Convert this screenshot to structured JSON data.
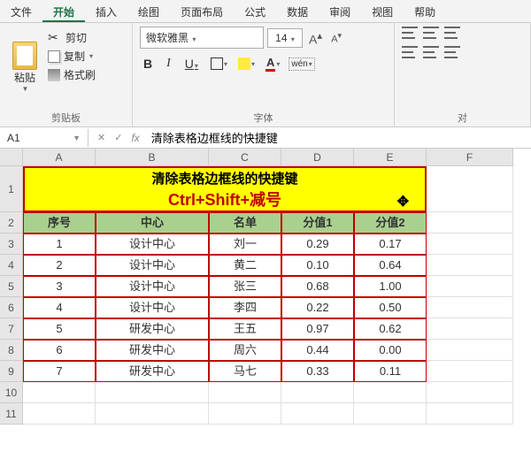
{
  "menu": {
    "items": [
      "文件",
      "开始",
      "插入",
      "绘图",
      "页面布局",
      "公式",
      "数据",
      "审阅",
      "视图",
      "帮助"
    ],
    "active_index": 1
  },
  "ribbon": {
    "clipboard": {
      "paste": "粘贴",
      "cut": "剪切",
      "copy": "复制",
      "format_painter": "格式刷",
      "group_label": "剪贴板"
    },
    "font": {
      "name": "微软雅黑",
      "size": "14",
      "increase": "A",
      "decrease": "A",
      "bold": "B",
      "italic": "I",
      "underline": "U",
      "font_color_glyph": "A",
      "phonetic": "wén",
      "group_label": "字体"
    },
    "align": {
      "group_label": "对"
    }
  },
  "namebox": "A1",
  "formula_fx": "fx",
  "formula_value": "清除表格边框线的快捷键",
  "columns": [
    "A",
    "B",
    "C",
    "D",
    "E",
    "F"
  ],
  "row_labels": [
    "1",
    "2",
    "3",
    "4",
    "5",
    "6",
    "7",
    "8",
    "9",
    "10",
    "11"
  ],
  "banner": {
    "title": "清除表格边框线的快捷键",
    "subtitle": "Ctrl+Shift+减号"
  },
  "table": {
    "headers": [
      "序号",
      "中心",
      "名单",
      "分值1",
      "分值2"
    ],
    "rows": [
      [
        "1",
        "设计中心",
        "刘一",
        "0.29",
        "0.17"
      ],
      [
        "2",
        "设计中心",
        "黄二",
        "0.10",
        "0.64"
      ],
      [
        "3",
        "设计中心",
        "张三",
        "0.68",
        "1.00"
      ],
      [
        "4",
        "设计中心",
        "李四",
        "0.22",
        "0.50"
      ],
      [
        "5",
        "研发中心",
        "王五",
        "0.97",
        "0.62"
      ],
      [
        "6",
        "研发中心",
        "周六",
        "0.44",
        "0.00"
      ],
      [
        "7",
        "研发中心",
        "马七",
        "0.33",
        "0.11"
      ]
    ]
  },
  "chart_data": {
    "type": "table",
    "title": "清除表格边框线的快捷键",
    "headers": [
      "序号",
      "中心",
      "名单",
      "分值1",
      "分值2"
    ],
    "rows": [
      [
        1,
        "设计中心",
        "刘一",
        0.29,
        0.17
      ],
      [
        2,
        "设计中心",
        "黄二",
        0.1,
        0.64
      ],
      [
        3,
        "设计中心",
        "张三",
        0.68,
        1.0
      ],
      [
        4,
        "设计中心",
        "李四",
        0.22,
        0.5
      ],
      [
        5,
        "研发中心",
        "王五",
        0.97,
        0.62
      ],
      [
        6,
        "研发中心",
        "周六",
        0.44,
        0.0
      ],
      [
        7,
        "研发中心",
        "马七",
        0.33,
        0.11
      ]
    ]
  }
}
